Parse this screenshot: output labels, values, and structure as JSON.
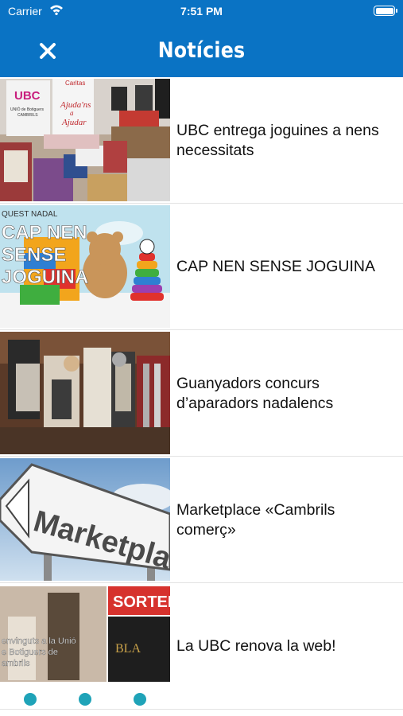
{
  "status_bar": {
    "carrier": "Carrier",
    "time": "7:51 PM"
  },
  "nav": {
    "title": "Notícies",
    "close_icon": "close-icon"
  },
  "news": [
    {
      "title": "UBC entrega joguines a nens necessitats",
      "thumb_text": [
        "UBC",
        "UNIÓ de Botiguers",
        "CAMBRILS",
        "Caritas",
        "Ajuda'ns",
        "a",
        "Ajudar"
      ]
    },
    {
      "title": "CAP NEN SENSE JOGUINA",
      "thumb_text": [
        "QUEST NADAL",
        "CAP NEN",
        "SENSE",
        "JOGUINA"
      ]
    },
    {
      "title": "Guanyadors concurs d’aparadors nadalencs",
      "thumb_text": []
    },
    {
      "title": "Marketplace «Cambrils comerç»",
      "thumb_text": [
        "Marketplace"
      ]
    },
    {
      "title": "La UBC renova la web!",
      "thumb_text": [
        "envinguts a la Unió",
        "e Botiguers de",
        "ambrils",
        "SORTEI",
        "BLA"
      ]
    }
  ],
  "tab_icons": [
    "list-icon",
    "star-icon",
    "send-icon"
  ],
  "colors": {
    "accent": "#0a73c4",
    "tab_icon": "#1fa3b8"
  }
}
